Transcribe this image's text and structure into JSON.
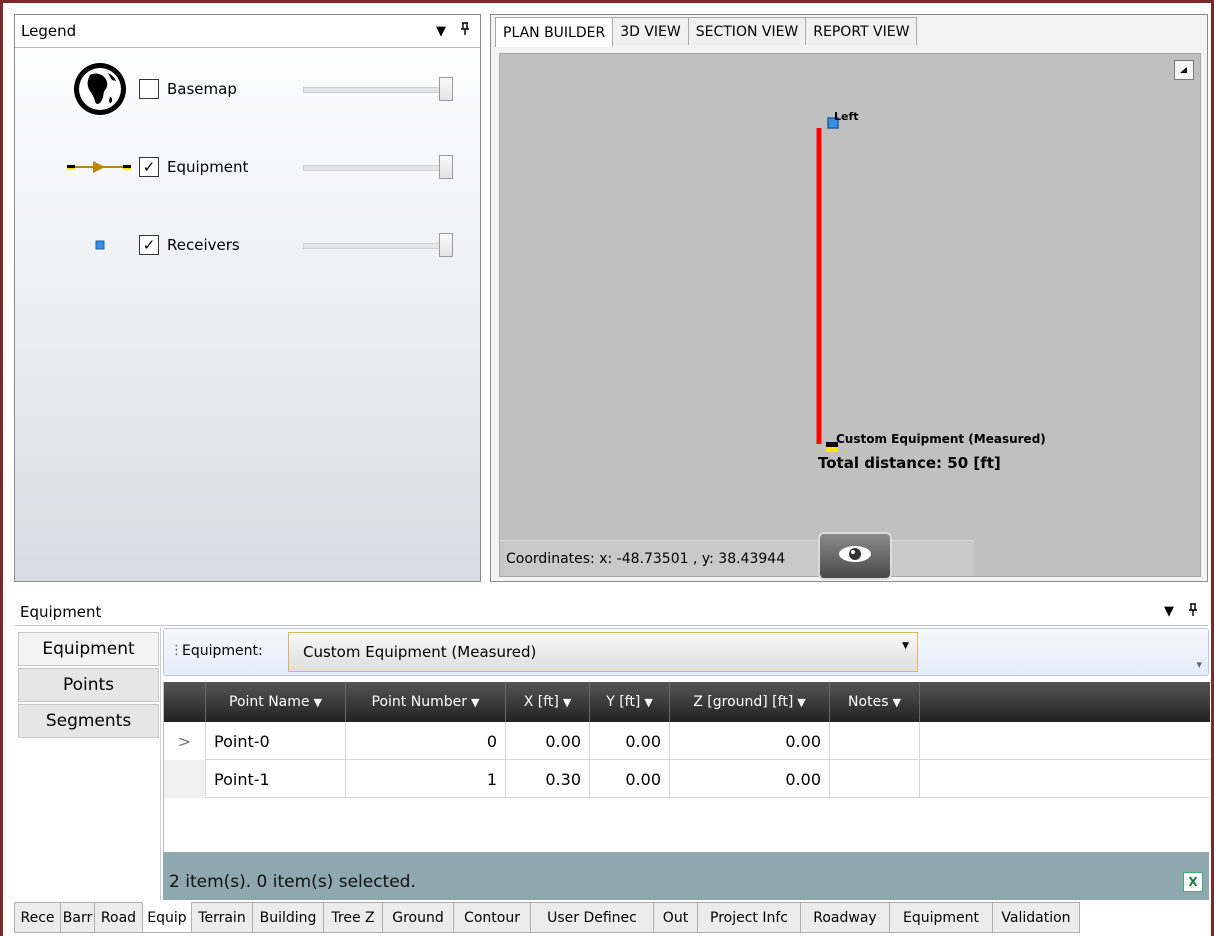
{
  "legend": {
    "title": "Legend",
    "items": [
      {
        "label": "Basemap",
        "checked": false,
        "icon": "globe-icon"
      },
      {
        "label": "Equipment",
        "checked": true,
        "icon": "equipment-arrow-icon"
      },
      {
        "label": "Receivers",
        "checked": true,
        "icon": "receiver-square-icon"
      }
    ]
  },
  "pane_buttons": {
    "dropdown": "▾",
    "pin": "ᵖ"
  },
  "view_tabs": [
    {
      "label": "PLAN BUILDER"
    },
    {
      "label": "3D VIEW"
    },
    {
      "label": "SECTION VIEW"
    },
    {
      "label": "REPORT VIEW"
    }
  ],
  "plan": {
    "receiver_label": "Left",
    "equipment_label": "Custom Equipment (Measured)",
    "total_distance": "Total distance: 50 [ft]",
    "coordinates": "Coordinates:  x: -48.73501 , y: 38.43944",
    "colors": {
      "line": "#ff0000",
      "receiver": "#3a8fe0",
      "equipment_fill": "#ffe600",
      "canvas": "#c0c0c0"
    }
  },
  "equipment_pane": {
    "title": "Equipment",
    "side_tabs": [
      "Equipment",
      "Points",
      "Segments"
    ],
    "toolbar_label": "Equipment:",
    "selected_equipment": "Custom Equipment (Measured)",
    "columns": [
      "Point Name",
      "Point Number",
      "X [ft]",
      "Y [ft]",
      "Z [ground] [ft]",
      "Notes"
    ],
    "rows": [
      {
        "selector": ">",
        "name": "Point-0",
        "number": "0",
        "x": "0.00",
        "y": "0.00",
        "z": "0.00",
        "notes": ""
      },
      {
        "selector": "",
        "name": "Point-1",
        "number": "1",
        "x": "0.30",
        "y": "0.00",
        "z": "0.00",
        "notes": ""
      }
    ],
    "status": "2 item(s). 0 item(s) selected."
  },
  "bottom_tabs": [
    "Rece",
    "Barr",
    "Road",
    "Equip",
    "Terrain",
    "Building",
    "Tree Z",
    "Ground",
    "Contour",
    "User Definec",
    "Out",
    "Project Infc",
    "Roadway",
    "Equipment",
    "Validation"
  ]
}
